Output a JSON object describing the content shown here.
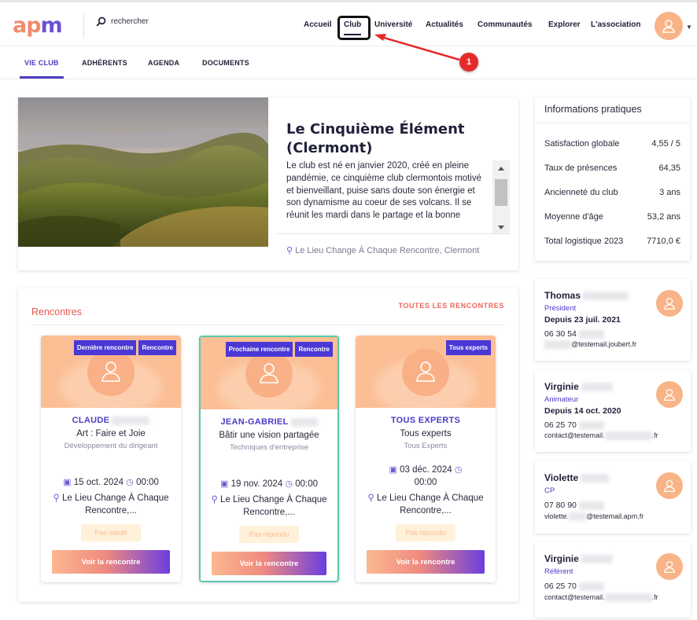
{
  "header": {
    "logo_text": "apm",
    "search_placeholder": "rechercher",
    "nav": [
      "Accueil",
      "Club",
      "Université",
      "Actualités",
      "Communautés",
      "Explorer",
      "L'association"
    ],
    "callout_number": "1"
  },
  "subnav": {
    "tabs": [
      "VIE CLUB",
      "ADHÉRENTS",
      "AGENDA",
      "DOCUMENTS"
    ],
    "active": "VIE CLUB"
  },
  "club": {
    "title": "Le Cinquième Élément (Clermont)",
    "description": "Le club est né en janvier 2020, créé en pleine pandémie, ce cinquième club clermontois motivé et bienveillant,  puise sans doute son énergie et son dynamisme au coeur de ses volcans. Il se réunit les mardi dans le partage et la bonne",
    "location": "Le Lieu Change À Chaque Rencontre, Clermont"
  },
  "info": {
    "title": "Informations pratiques",
    "rows": [
      {
        "label": "Satisfaction globale",
        "value": "4,55 / 5"
      },
      {
        "label": "Taux de présences",
        "value": "64,35"
      },
      {
        "label": "Ancienneté du club",
        "value": "3 ans"
      },
      {
        "label": "Moyenne d'âge",
        "value": "53,2 ans"
      },
      {
        "label": "Total logistique 2023",
        "value": "7710,0 €"
      }
    ]
  },
  "meetings": {
    "title": "Rencontres",
    "all_link": "TOUTES LES RENCONTRES",
    "cards": [
      {
        "badges": [
          "Dernière rencontre",
          "Rencontre"
        ],
        "name": "CLAUDE",
        "subject": "Art : Faire et Joie",
        "category": "Développement du dirigeant",
        "date": "15 oct. 2024",
        "time": "00:00",
        "location": "Le Lieu Change À Chaque Rencontre,...",
        "status": "Pas validé",
        "button": "Voir la rencontre"
      },
      {
        "badges": [
          "Prochaine rencontre",
          "Rencontre"
        ],
        "name": "JEAN-GABRIEL",
        "subject": "Bâtir une vision partagée",
        "category": "Techniques d'entreprise",
        "date": "19 nov. 2024",
        "time": "00:00",
        "location": "Le Lieu Change À Chaque Rencontre,...",
        "status": "Pas répondu",
        "button": "Voir la rencontre"
      },
      {
        "badges": [
          "Tous experts"
        ],
        "name": "TOUS EXPERTS",
        "subject": "Tous experts",
        "category": "Tous Experts",
        "date": "03 déc. 2024",
        "time": "00:00",
        "location": "Le Lieu Change À Chaque Rencontre,...",
        "status": "Pas répondu",
        "button": "Voir la rencontre"
      }
    ]
  },
  "people": [
    {
      "name": "Thomas",
      "role": "Président",
      "since": "Depuis 23 juil. 2021",
      "phone": "06 30 54",
      "email_suffix": "@testemail.joubert.fr"
    },
    {
      "name": "Virginie",
      "role": "Animateur",
      "since": "Depuis 14 oct. 2020",
      "phone": "06 25 70",
      "email_prefix": "contact@testemail.",
      "email_suffix": ".fr"
    },
    {
      "name": "Violette",
      "role": "CP",
      "phone": "07 80 90",
      "email_prefix": "violette.",
      "email_suffix": "@testemail.apm.fr"
    },
    {
      "name": "Virginie",
      "role": "Référent",
      "phone": "06 25 70",
      "email_prefix": "contact@testemail.",
      "email_suffix": ".fr"
    }
  ],
  "colors": {
    "accent": "#4b3cc4",
    "orange": "#f8b486",
    "red": "#e52a2a",
    "teal": "#5cc9ad"
  }
}
